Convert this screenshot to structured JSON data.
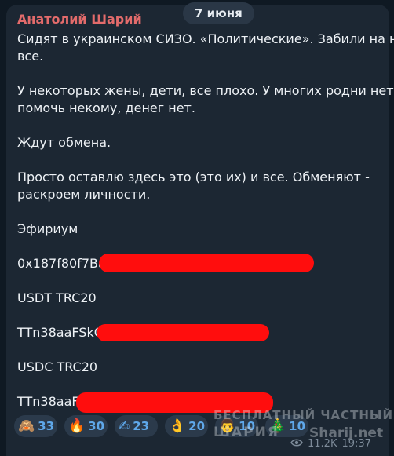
{
  "date_pill": "7 июня",
  "message": {
    "author": "Анатолий Шарий",
    "lines": [
      "Сидят в украинском СИЗО. «Политические». Забили на них",
      "все.",
      "У некоторых жены, дети, все плохо. У многих родни нет,",
      "помочь некому, денег нет.",
      "Ждут обмена.",
      "Просто оставлю здесь это (это их) и все. Обменяют -",
      "раскроем личности.",
      "Эфириум",
      "0x187f80f7Ba6",
      "USDT TRC20",
      "TTn38aaFSkCS",
      "USDC TRC20",
      "TTn38aaF9"
    ]
  },
  "reactions": [
    {
      "emoji": "🙈",
      "count": "33"
    },
    {
      "emoji": "🔥",
      "count": "30"
    },
    {
      "emoji": "✍",
      "count": "23"
    },
    {
      "emoji": "👌",
      "count": "20"
    },
    {
      "emoji": "👨",
      "count": "10"
    },
    {
      "emoji": "🎄",
      "count": "10"
    }
  ],
  "watermark": {
    "line1": "БЕСПЛАТНЫЙ  ЧАСТНЫЙ",
    "line2": "ШАРИЯ",
    "site": "Sharij.net"
  },
  "meta": {
    "views": "11.2K",
    "time": "19:37"
  },
  "colors": {
    "author": "#e36b6b",
    "bubble": "#1c2733",
    "reaction_bg": "#2b3a4b",
    "reaction_text": "#5fa8ea",
    "redaction": "#ff0d0d"
  }
}
